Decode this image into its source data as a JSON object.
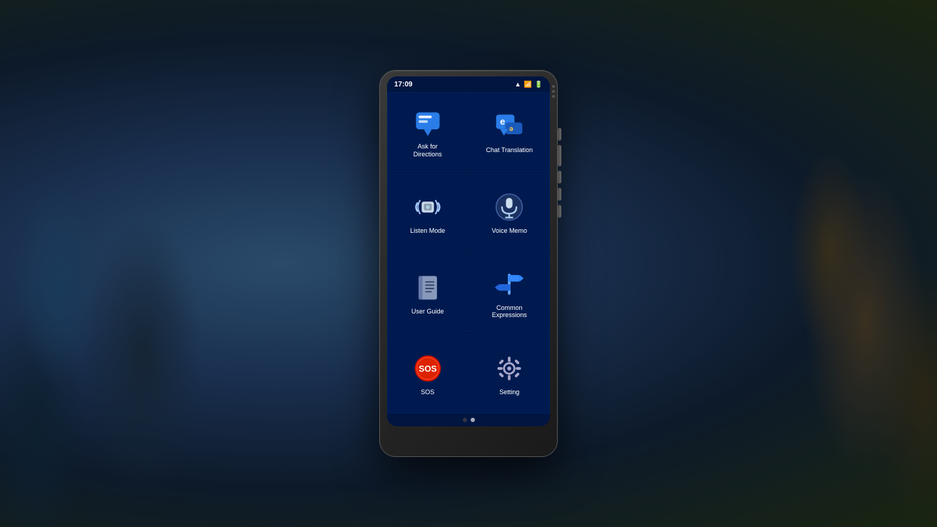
{
  "background": {
    "description": "Forest/nature scene with blue-teal tones on left, warm tones on right"
  },
  "device": {
    "status_bar": {
      "time": "17:09",
      "wifi_label": "wifi",
      "battery_label": "battery"
    },
    "apps": [
      {
        "id": "ask-for-directions",
        "label": "Ask for\nDirections",
        "label_line1": "Ask for",
        "label_line2": "Directions",
        "icon_type": "chat-bubble",
        "icon_color": "#2a7de8"
      },
      {
        "id": "chat-translation",
        "label": "Chat Translation",
        "label_line1": "Chat Translation",
        "label_line2": "",
        "icon_type": "chat-e",
        "icon_color": "#2a7de8"
      },
      {
        "id": "listen-mode",
        "label": "Listen Mode",
        "label_line1": "Listen Mode",
        "label_line2": "",
        "icon_type": "listen",
        "icon_color": "#aaccff"
      },
      {
        "id": "voice-memo",
        "label": "Voice Memo",
        "label_line1": "Voice Memo",
        "label_line2": "",
        "icon_type": "microphone",
        "icon_color": "#aaccff"
      },
      {
        "id": "user-guide",
        "label": "User Guide",
        "label_line1": "User Guide",
        "label_line2": "",
        "icon_type": "book",
        "icon_color": "#99aacc"
      },
      {
        "id": "common-expressions",
        "label": "Common\nExpressions",
        "label_line1": "Common",
        "label_line2": "Expressions",
        "icon_type": "signpost",
        "icon_color": "#66aaff"
      },
      {
        "id": "sos",
        "label": "SOS",
        "label_line1": "SOS",
        "label_line2": "",
        "icon_type": "sos",
        "icon_color": "#cc2200"
      },
      {
        "id": "setting",
        "label": "Setting",
        "label_line1": "Setting",
        "label_line2": "",
        "icon_type": "gear",
        "icon_color": "#aaaacc"
      }
    ],
    "page_dots": [
      {
        "active": false
      },
      {
        "active": true
      }
    ]
  }
}
